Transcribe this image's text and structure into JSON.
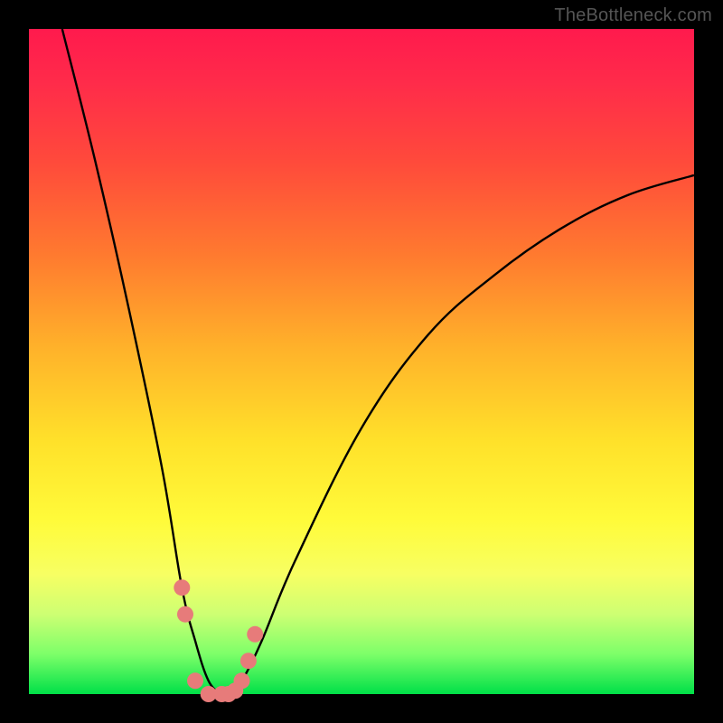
{
  "attribution": "TheBottleneck.com",
  "chart_data": {
    "type": "line",
    "title": "",
    "xlabel": "",
    "ylabel": "",
    "xlim": [
      0,
      100
    ],
    "ylim": [
      0,
      100
    ],
    "grid": false,
    "legend": false,
    "series": [
      {
        "name": "bottleneck-curve",
        "x": [
          5,
          10,
          15,
          20,
          23,
          25,
          27,
          29,
          30,
          32,
          35,
          40,
          50,
          60,
          70,
          80,
          90,
          100
        ],
        "y": [
          100,
          80,
          58,
          34,
          16,
          8,
          2,
          0,
          0,
          2,
          8,
          20,
          40,
          54,
          63,
          70,
          75,
          78
        ]
      }
    ],
    "markers": {
      "name": "highlighted-points",
      "x": [
        23,
        23.5,
        25,
        27,
        29,
        30,
        31,
        32,
        33,
        34
      ],
      "y": [
        16,
        12,
        2,
        0,
        0,
        0,
        0.5,
        2,
        5,
        9
      ]
    },
    "background_gradient": {
      "stops": [
        {
          "pos": 0.0,
          "color": "#ff1a4d"
        },
        {
          "pos": 0.2,
          "color": "#ff4a3b"
        },
        {
          "pos": 0.48,
          "color": "#ffb22a"
        },
        {
          "pos": 0.74,
          "color": "#fffb3a"
        },
        {
          "pos": 0.94,
          "color": "#7dff69"
        },
        {
          "pos": 1.0,
          "color": "#00e048"
        }
      ]
    }
  }
}
